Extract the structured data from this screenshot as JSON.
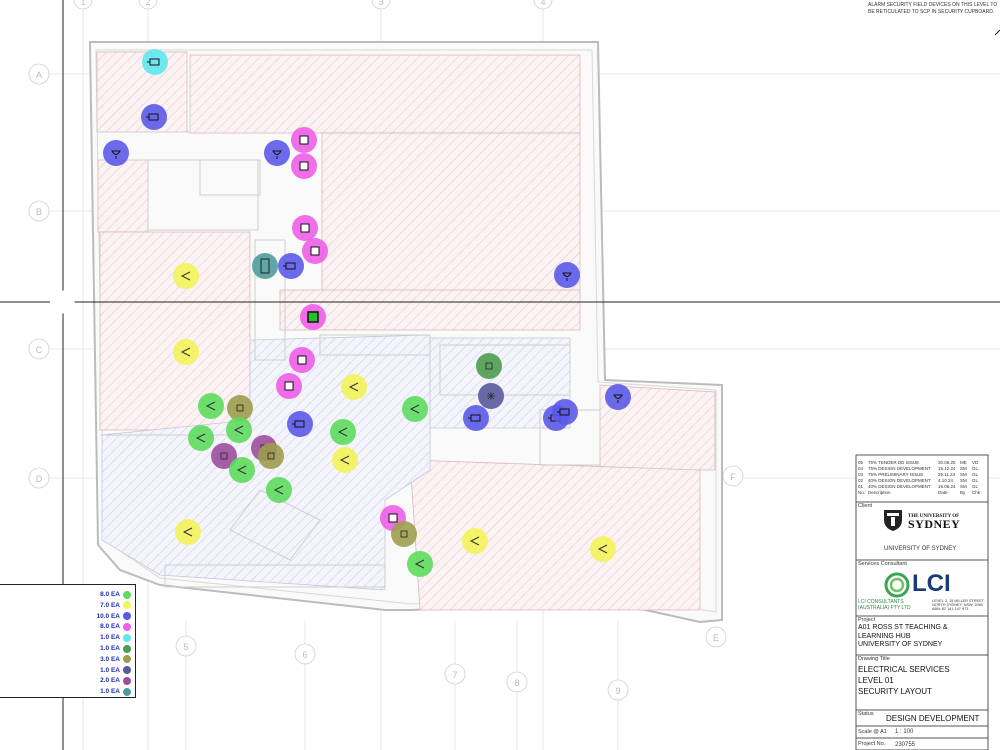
{
  "note": {
    "line1": "ALARM SECURITY FIELD DEVICES ON THIS LEVEL TO",
    "line2": "BE RETICULATED TO SCP IN SECURITY CUPBOARD."
  },
  "grid": {
    "columns": [
      "1",
      "2",
      "3",
      "4",
      "5",
      "6",
      "7",
      "8",
      "9"
    ],
    "rows": [
      "A",
      "B",
      "C",
      "D",
      "E",
      "F"
    ]
  },
  "legend": [
    {
      "qty": "8.0 EA",
      "color": "#5ddc5d"
    },
    {
      "qty": "7.0 EA",
      "color": "#f3f35a"
    },
    {
      "qty": "10.0 EA",
      "color": "#5a5ae8"
    },
    {
      "qty": "8.0 EA",
      "color": "#ee5ee8"
    },
    {
      "qty": "1.0 EA",
      "color": "#5de8ee"
    },
    {
      "qty": "1.0 EA",
      "color": "#4e9d4e"
    },
    {
      "qty": "3.0 EA",
      "color": "#9d9d4e"
    },
    {
      "qty": "1.0 EA",
      "color": "#5a5a9d"
    },
    {
      "qty": "2.0 EA",
      "color": "#9d4e9d"
    },
    {
      "qty": "1.0 EA",
      "color": "#4e9d9d"
    }
  ],
  "markers": [
    {
      "type": "cyan",
      "icon": "camera"
    },
    {
      "type": "blue",
      "icon": "camera"
    },
    {
      "type": "blue",
      "icon": "dome"
    },
    {
      "type": "blue",
      "icon": "dome"
    },
    {
      "type": "magenta",
      "icon": "door"
    },
    {
      "type": "magenta",
      "icon": "door"
    },
    {
      "type": "magenta",
      "icon": "door"
    },
    {
      "type": "magenta",
      "icon": "door"
    },
    {
      "type": "teal",
      "icon": "rect"
    },
    {
      "type": "blue",
      "icon": "camera"
    },
    {
      "type": "blue",
      "icon": "dome"
    },
    {
      "type": "yellow",
      "icon": "pir"
    },
    {
      "type": "magenta",
      "icon": "square"
    },
    {
      "type": "yellow",
      "icon": "pir"
    },
    {
      "type": "magenta",
      "icon": "door"
    },
    {
      "type": "magenta",
      "icon": "door"
    },
    {
      "type": "yellow",
      "icon": "pir"
    },
    {
      "type": "darkgreen",
      "icon": "box"
    },
    {
      "type": "navy",
      "icon": "star"
    },
    {
      "type": "green",
      "icon": "pir"
    },
    {
      "type": "olive",
      "icon": "box"
    },
    {
      "type": "green",
      "icon": "pir"
    },
    {
      "type": "blue",
      "icon": "camera"
    },
    {
      "type": "green",
      "icon": "pir"
    },
    {
      "type": "green",
      "icon": "pir"
    },
    {
      "type": "blue",
      "icon": "camera"
    },
    {
      "type": "blue",
      "icon": "camera"
    },
    {
      "type": "blue",
      "icon": "camera"
    },
    {
      "type": "blue",
      "icon": "dome"
    },
    {
      "type": "green",
      "icon": "pir"
    },
    {
      "type": "purple",
      "icon": "box"
    },
    {
      "type": "purple",
      "icon": "box"
    },
    {
      "type": "olive",
      "icon": "box"
    },
    {
      "type": "yellow",
      "icon": "pir"
    },
    {
      "type": "green",
      "icon": "pir"
    },
    {
      "type": "green",
      "icon": "pir"
    },
    {
      "type": "yellow",
      "icon": "pir"
    },
    {
      "type": "magenta",
      "icon": "door"
    },
    {
      "type": "olive",
      "icon": "box"
    },
    {
      "type": "green",
      "icon": "pir"
    },
    {
      "type": "yellow",
      "icon": "pir"
    },
    {
      "type": "yellow",
      "icon": "pir"
    }
  ],
  "revisions": [
    [
      "05",
      "75% TENDER DD ISSUE",
      "30.06.25",
      "ME",
      "VD"
    ],
    [
      "04",
      "75% DESIGN DEVELOPMENT",
      "15.12.24",
      "SM",
      "GL"
    ],
    [
      "03",
      "75% PRELIMINARY ISSUE",
      "29.11.24",
      "SM",
      "GL"
    ],
    [
      "02",
      "40% DESIGN DEVELOPMENT",
      "4.10.24",
      "SM",
      "GL"
    ],
    [
      "01",
      "40% DESIGN DEVELOPMENT",
      "19.06.24",
      "SM",
      "GL"
    ]
  ],
  "revision_header": [
    "No.",
    "Description",
    "Date",
    "By",
    "Chk"
  ],
  "title_block": {
    "client_label": "Client",
    "client_logo_line1": "THE UNIVERSITY OF",
    "client_logo_line2": "SYDNEY",
    "client_name": "UNIVERSITY OF SYDNEY",
    "consultant_label": "Services Consultant",
    "consultant_logo": "LCI",
    "consultant_name1": "LCI CONSULTANTS",
    "consultant_name2": "(AUSTRALIA) PTY LTD",
    "consultant_address1": "LEVEL 3, 15 MILLER STREET,",
    "consultant_address2": "NORTH SYDNEY, NSW, 2060",
    "consultant_address3": "ABN: 82 141 147 973",
    "project_label": "Project",
    "project_line1": "A01 ROSS ST TEACHING &",
    "project_line2": "LEARNING HUB",
    "project_line3": "UNIVERSITY OF SYDNEY",
    "drawing_title_label": "Drawing Title",
    "drawing_line1": "ELECTRICAL SERVICES",
    "drawing_line2": "LEVEL 01",
    "drawing_line3": "SECURITY LAYOUT",
    "status_label": "Status",
    "status": "DESIGN DEVELOPMENT",
    "scale_label": "Scale @ A1",
    "scale": "1 : 100",
    "project_no_label": "Project No.",
    "project_no": "230755"
  }
}
